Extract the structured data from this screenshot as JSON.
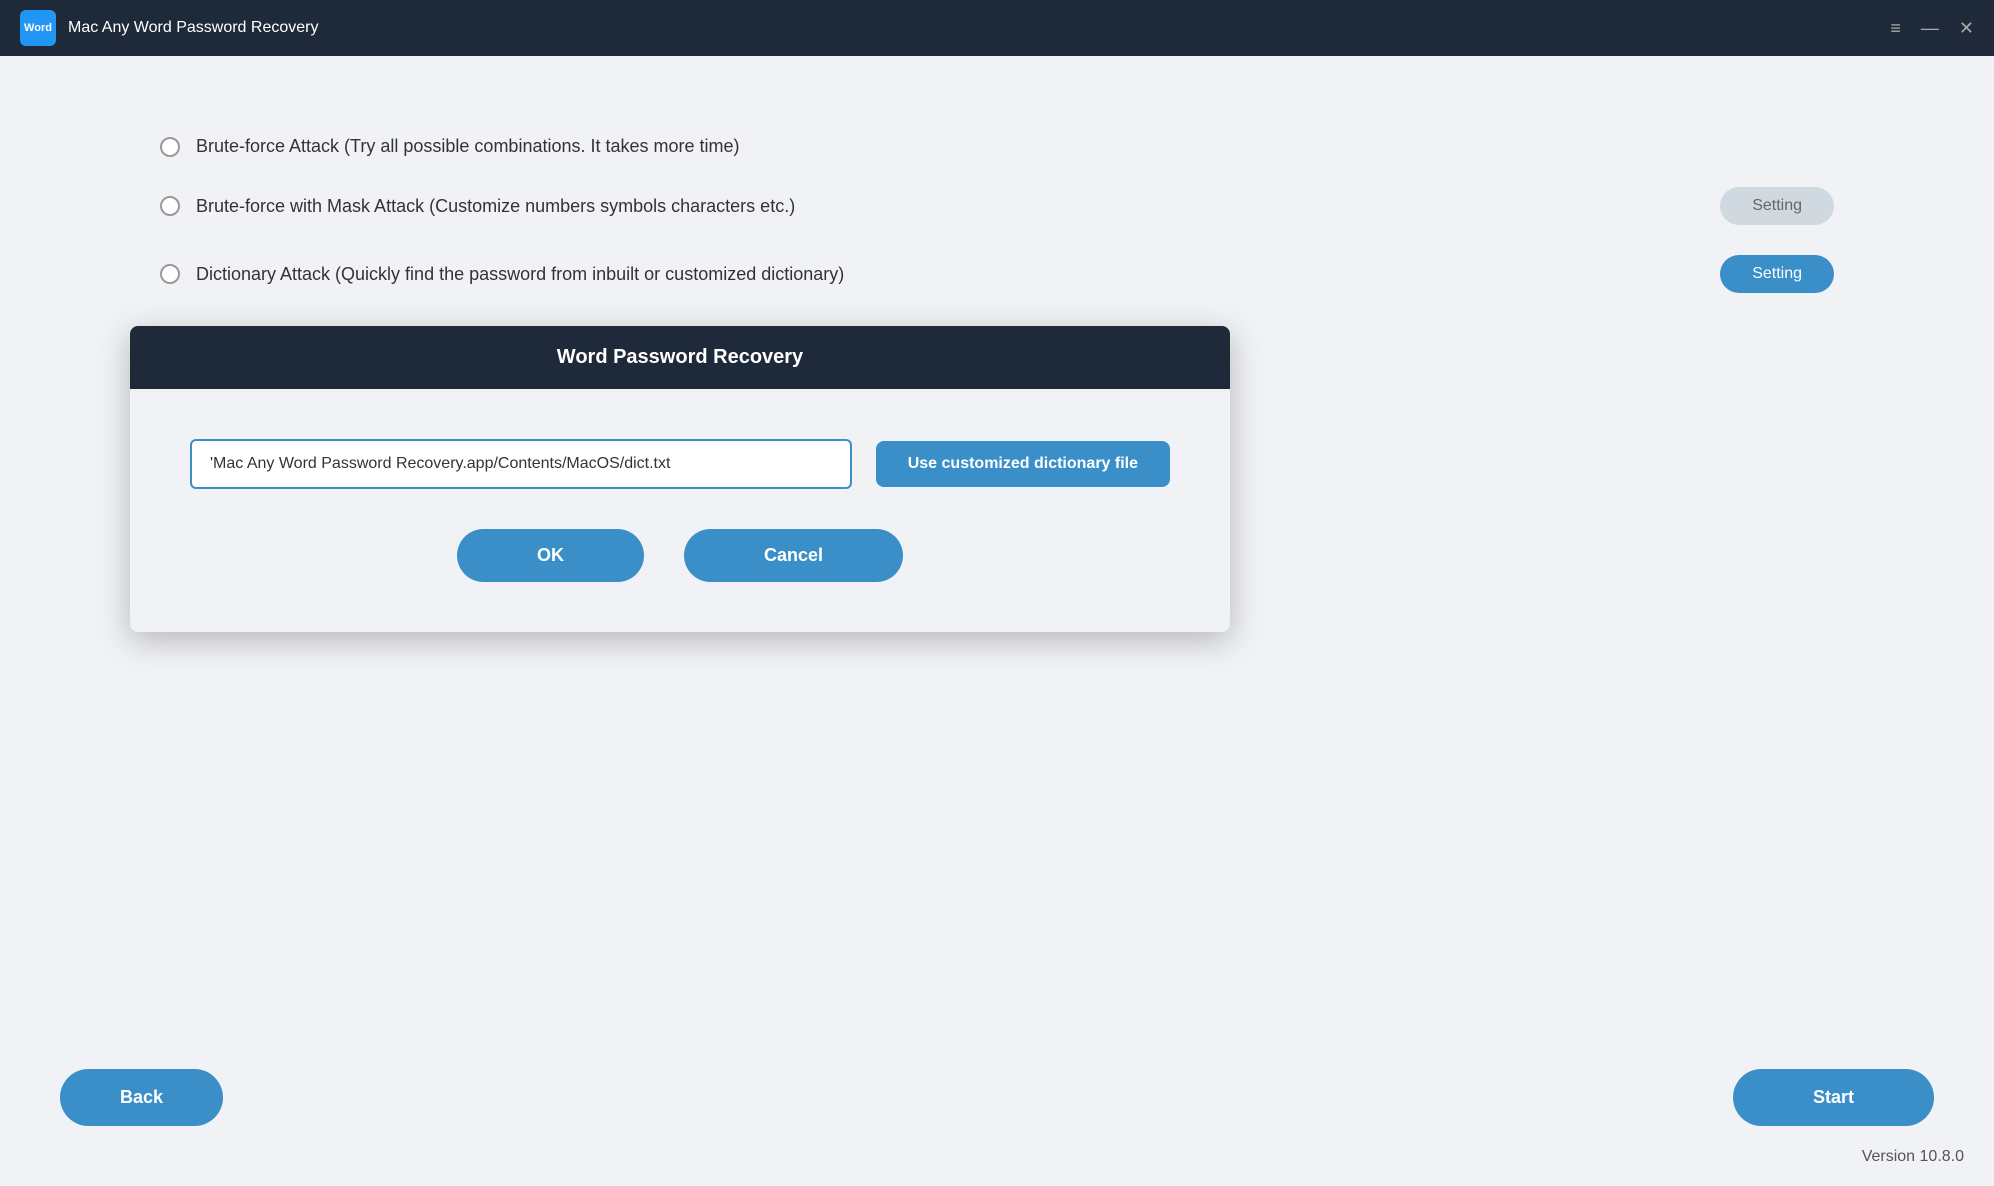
{
  "titlebar": {
    "icon_label": "Word",
    "title": "Mac Any Word Password Recovery",
    "menu_icon": "≡",
    "minimize_icon": "—",
    "close_icon": "✕"
  },
  "attack_options": [
    {
      "id": "brute-force",
      "label": "Brute-force Attack (Try all possible combinations. It takes more time)",
      "selected": false,
      "has_setting": false
    },
    {
      "id": "brute-force-mask",
      "label": "Brute-force with Mask Attack (Customize numbers symbols characters etc.)",
      "selected": false,
      "has_setting": true,
      "setting_label": "Setting",
      "setting_active": false
    },
    {
      "id": "dictionary",
      "label": "Dictionary Attack (Quickly find the password from inbuilt or customized dictionary)",
      "selected": false,
      "has_setting": true,
      "setting_label": "Setting",
      "setting_active": true
    }
  ],
  "dialog": {
    "title": "Word Password Recovery",
    "input_value": "'Mac Any Word Password Recovery.app/Contents/MacOS/dict.txt",
    "input_placeholder": "",
    "use_dict_btn_label": "Use customized dictionary file",
    "ok_label": "OK",
    "cancel_label": "Cancel"
  },
  "bottom": {
    "back_label": "Back",
    "start_label": "Start"
  },
  "version": "Version 10.8.0"
}
